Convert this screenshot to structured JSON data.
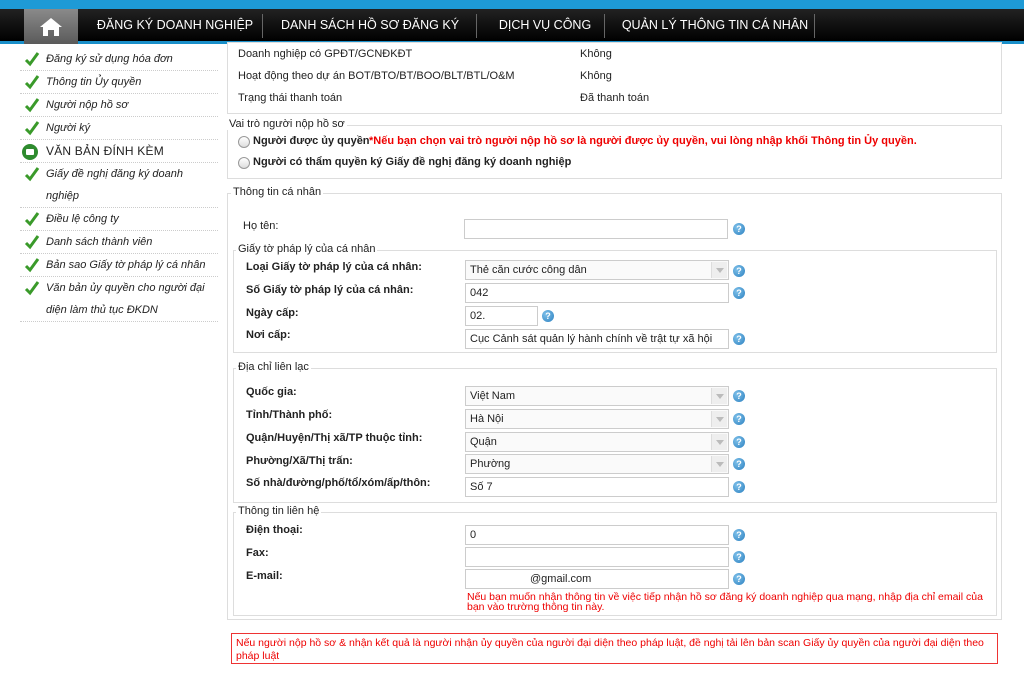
{
  "nav": {
    "items": [
      "ĐĂNG KÝ DOANH NGHIỆP",
      "DANH SÁCH HỒ SƠ ĐĂNG KÝ",
      "DỊCH VỤ CÔNG",
      "QUẢN LÝ THÔNG TIN CÁ NHÂN"
    ]
  },
  "sidebar": {
    "items": [
      "Đăng ký sử dụng hóa đơn",
      "Thông tin Ủy quyền",
      "Người nộp hồ sơ",
      "Người ký"
    ],
    "section_title": "VĂN BẢN ĐÍNH KÈM",
    "attachments": [
      "Giấy đề nghị đăng ký doanh nghiệp",
      "Điều lệ công ty",
      "Danh sách thành viên",
      "Bản sao Giấy tờ pháp lý cá nhân",
      "Văn bản ủy quyền cho người đại diện làm thủ tục ĐKDN"
    ]
  },
  "summary": {
    "rows": [
      {
        "label": "Doanh nghiệp có GPĐT/GCNĐKĐT",
        "value": "Không"
      },
      {
        "label": "Hoạt động theo dự án BOT/BTO/BT/BOO/BLT/BTL/O&M",
        "value": "Không"
      },
      {
        "label": "Trạng thái thanh toán",
        "value": "Đã thanh toán"
      }
    ]
  },
  "role": {
    "legend": "Vai trò người nộp hồ sơ",
    "option1": "Người được ủy quyền",
    "note": "*Nếu bạn chọn vai trò người nộp hồ sơ là người được ủy quyền, vui lòng nhập khối Thông tin Ủy quyền.",
    "option2": "Người có thẩm quyền ký Giấy đề nghị đăng ký doanh nghiệp"
  },
  "personal": {
    "legend": "Thông tin cá nhân",
    "name_label": "Họ tên:",
    "name_value": ""
  },
  "legal": {
    "legend": "Giấy tờ pháp lý của cá nhân",
    "type_label": "Loại Giấy tờ pháp lý của cá nhân:",
    "type_value": "Thẻ căn cước công dân",
    "number_label": "Số Giấy tờ pháp lý của cá nhân:",
    "number_value": "042",
    "date_label": "Ngày cấp:",
    "date_value": "02.",
    "place_label": "Nơi cấp:",
    "place_value": "Cục Cảnh sát quản lý hành chính về trật tự xã hội"
  },
  "address": {
    "legend": "Địa chỉ liên lạc",
    "country_label": "Quốc gia:",
    "country_value": "Việt Nam",
    "province_label": "Tỉnh/Thành phố:",
    "province_value": "Hà Nội",
    "district_label": "Quận/Huyện/Thị xã/TP thuộc tỉnh:",
    "district_value": "Quận",
    "ward_label": "Phường/Xã/Thị trấn:",
    "ward_value": "Phường",
    "street_label": "Số nhà/đường/phố/tổ/xóm/ấp/thôn:",
    "street_value": "Số 7"
  },
  "contact": {
    "legend": "Thông tin liên hệ",
    "phone_label": "Điện thoại:",
    "phone_value": "0",
    "fax_label": "Fax:",
    "fax_value": "",
    "email_label": "E-mail:",
    "email_value": "@gmail.com",
    "email_note": "Nếu bạn muốn nhận thông tin về việc tiếp nhận hồ sơ đăng ký doanh nghiệp qua mạng, nhập địa chỉ email của bạn vào trường thông tin này."
  },
  "warning": "Nếu người nộp hồ sơ & nhận kết quả là người nhận ủy quyền của người đại diện theo pháp luật, đề nghị tải lên bản scan Giấy ủy quyền của người đại diện theo pháp luật",
  "colors": {
    "accent": "#1e9ad6",
    "check_green": "#3a9a2a",
    "warning_red": "#e00000"
  }
}
